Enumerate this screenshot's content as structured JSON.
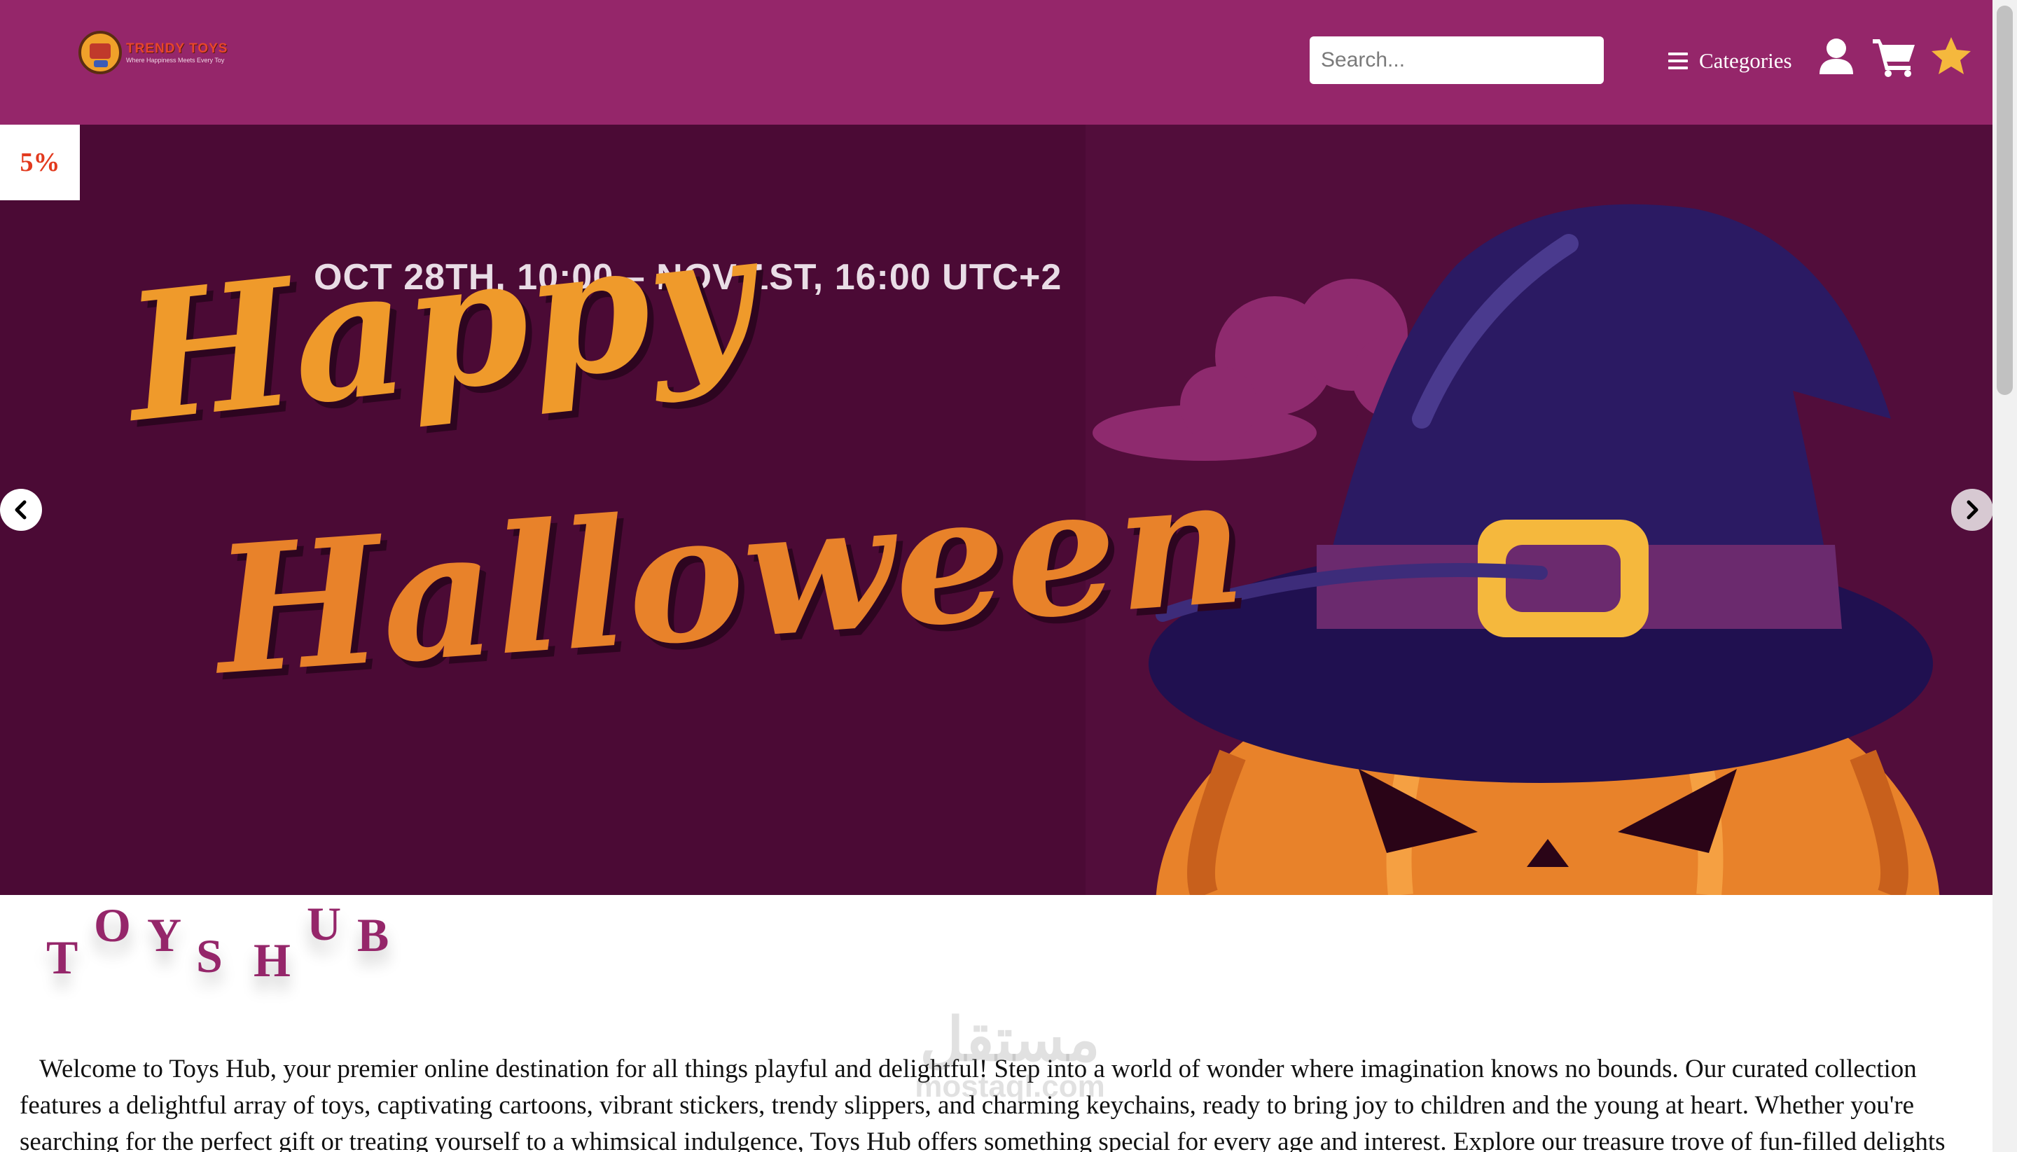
{
  "header": {
    "logo": {
      "name": "TRENDY TOYS",
      "tagline": "Where Happiness Meets Every Toy"
    },
    "search": {
      "placeholder": "Search...",
      "value": ""
    },
    "categories_label": "Categories",
    "icons": [
      "hamburger-icon",
      "user-icon",
      "cart-icon",
      "star-icon"
    ],
    "colors": {
      "bar": "#95266a",
      "star": "#f5b83d"
    }
  },
  "hero": {
    "discount_badge": "5%",
    "date_text": "OCT 28TH, 10:00 – NOV 1ST, 16:00 UTC+2",
    "headline_line1": "Happy",
    "headline_line2": "Halloween",
    "colors": {
      "background": "#4b0a35",
      "headline": "#ef9a2b"
    }
  },
  "brand": {
    "letters": [
      "T",
      "O",
      "Y",
      "S",
      "H",
      "U",
      "B"
    ],
    "color": "#95266a"
  },
  "intro": {
    "text": "Welcome to Toys Hub, your premier online destination for all things playful and delightful! Step into a world of wonder where imagination knows no bounds. Our curated collection features a delightful array of toys, captivating cartoons, vibrant stickers, trendy slippers, and charming keychains, ready to bring joy to children and the young at heart. Whether you're searching for the perfect gift or treating yourself to a whimsical indulgence, Toys Hub offers something special for every age and interest. Explore our treasure trove of fun-filled delights and embark on a journey filled with laughter, creativity, and endless smiles. Experience the magic of Toys Hub today and"
  },
  "watermark": {
    "script": "مستقل",
    "domain": "mostaql.com"
  }
}
